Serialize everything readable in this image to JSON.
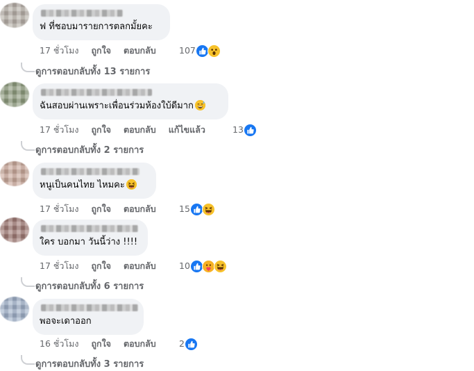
{
  "comments": [
    {
      "text": "ฟ ที่ชอบมารายการตลกมั้ยคะ",
      "text_emoji": "",
      "time": "17 ชั่วโมง",
      "like": "ถูกใจ",
      "reply": "ตอบกลับ",
      "edited": "",
      "reaction_count": "107",
      "reaction_icons": [
        "like-icon",
        "wow-icon"
      ],
      "replies": "ดูการตอบกลับทั้ง 13 รายการ",
      "avatar_color": "#b7b0a8"
    },
    {
      "text": "ฉันสอบผ่านเพราะเพื่อนร่วมห้องใบ้ดีมาก",
      "text_emoji": "grinning-sweat-emoji",
      "time": "17 ชั่วโมง",
      "like": "ถูกใจ",
      "reply": "ตอบกลับ",
      "edited": "แก้ไขแล้ว",
      "reaction_count": "13",
      "reaction_icons": [
        "like-icon"
      ],
      "replies": "ดูการตอบกลับทั้ง 2 รายการ",
      "avatar_color": "#8e9b7e"
    },
    {
      "text": "หนูเป็นคนไทย ไหมคะ",
      "text_emoji": "laughing-emoji",
      "time": "17 ชั่วโมง",
      "like": "ถูกใจ",
      "reply": "ตอบกลับ",
      "edited": "",
      "reaction_count": "15",
      "reaction_icons": [
        "like-icon",
        "haha-icon"
      ],
      "replies": "",
      "avatar_color": "#c9a89a"
    },
    {
      "text": "ใคร บอกมา วันนี้ว่าง !!!!",
      "text_emoji": "",
      "time": "17 ชั่วโมง",
      "like": "ถูกใจ",
      "reply": "ตอบกลับ",
      "edited": "",
      "reaction_count": "10",
      "reaction_icons": [
        "like-icon",
        "care-icon",
        "haha-icon"
      ],
      "replies": "ดูการตอบกลับทั้ง 6 รายการ",
      "avatar_color": "#a07a74"
    },
    {
      "text": "พอจะเดาออก",
      "text_emoji": "",
      "time": "16 ชั่วโมง",
      "like": "ถูกใจ",
      "reply": "ตอบกลับ",
      "edited": "",
      "reaction_count": "2",
      "reaction_icons": [
        "like-icon"
      ],
      "replies": "ดูการตอบกลับทั้ง 3 รายการ",
      "avatar_color": "#9fb0c8"
    }
  ]
}
